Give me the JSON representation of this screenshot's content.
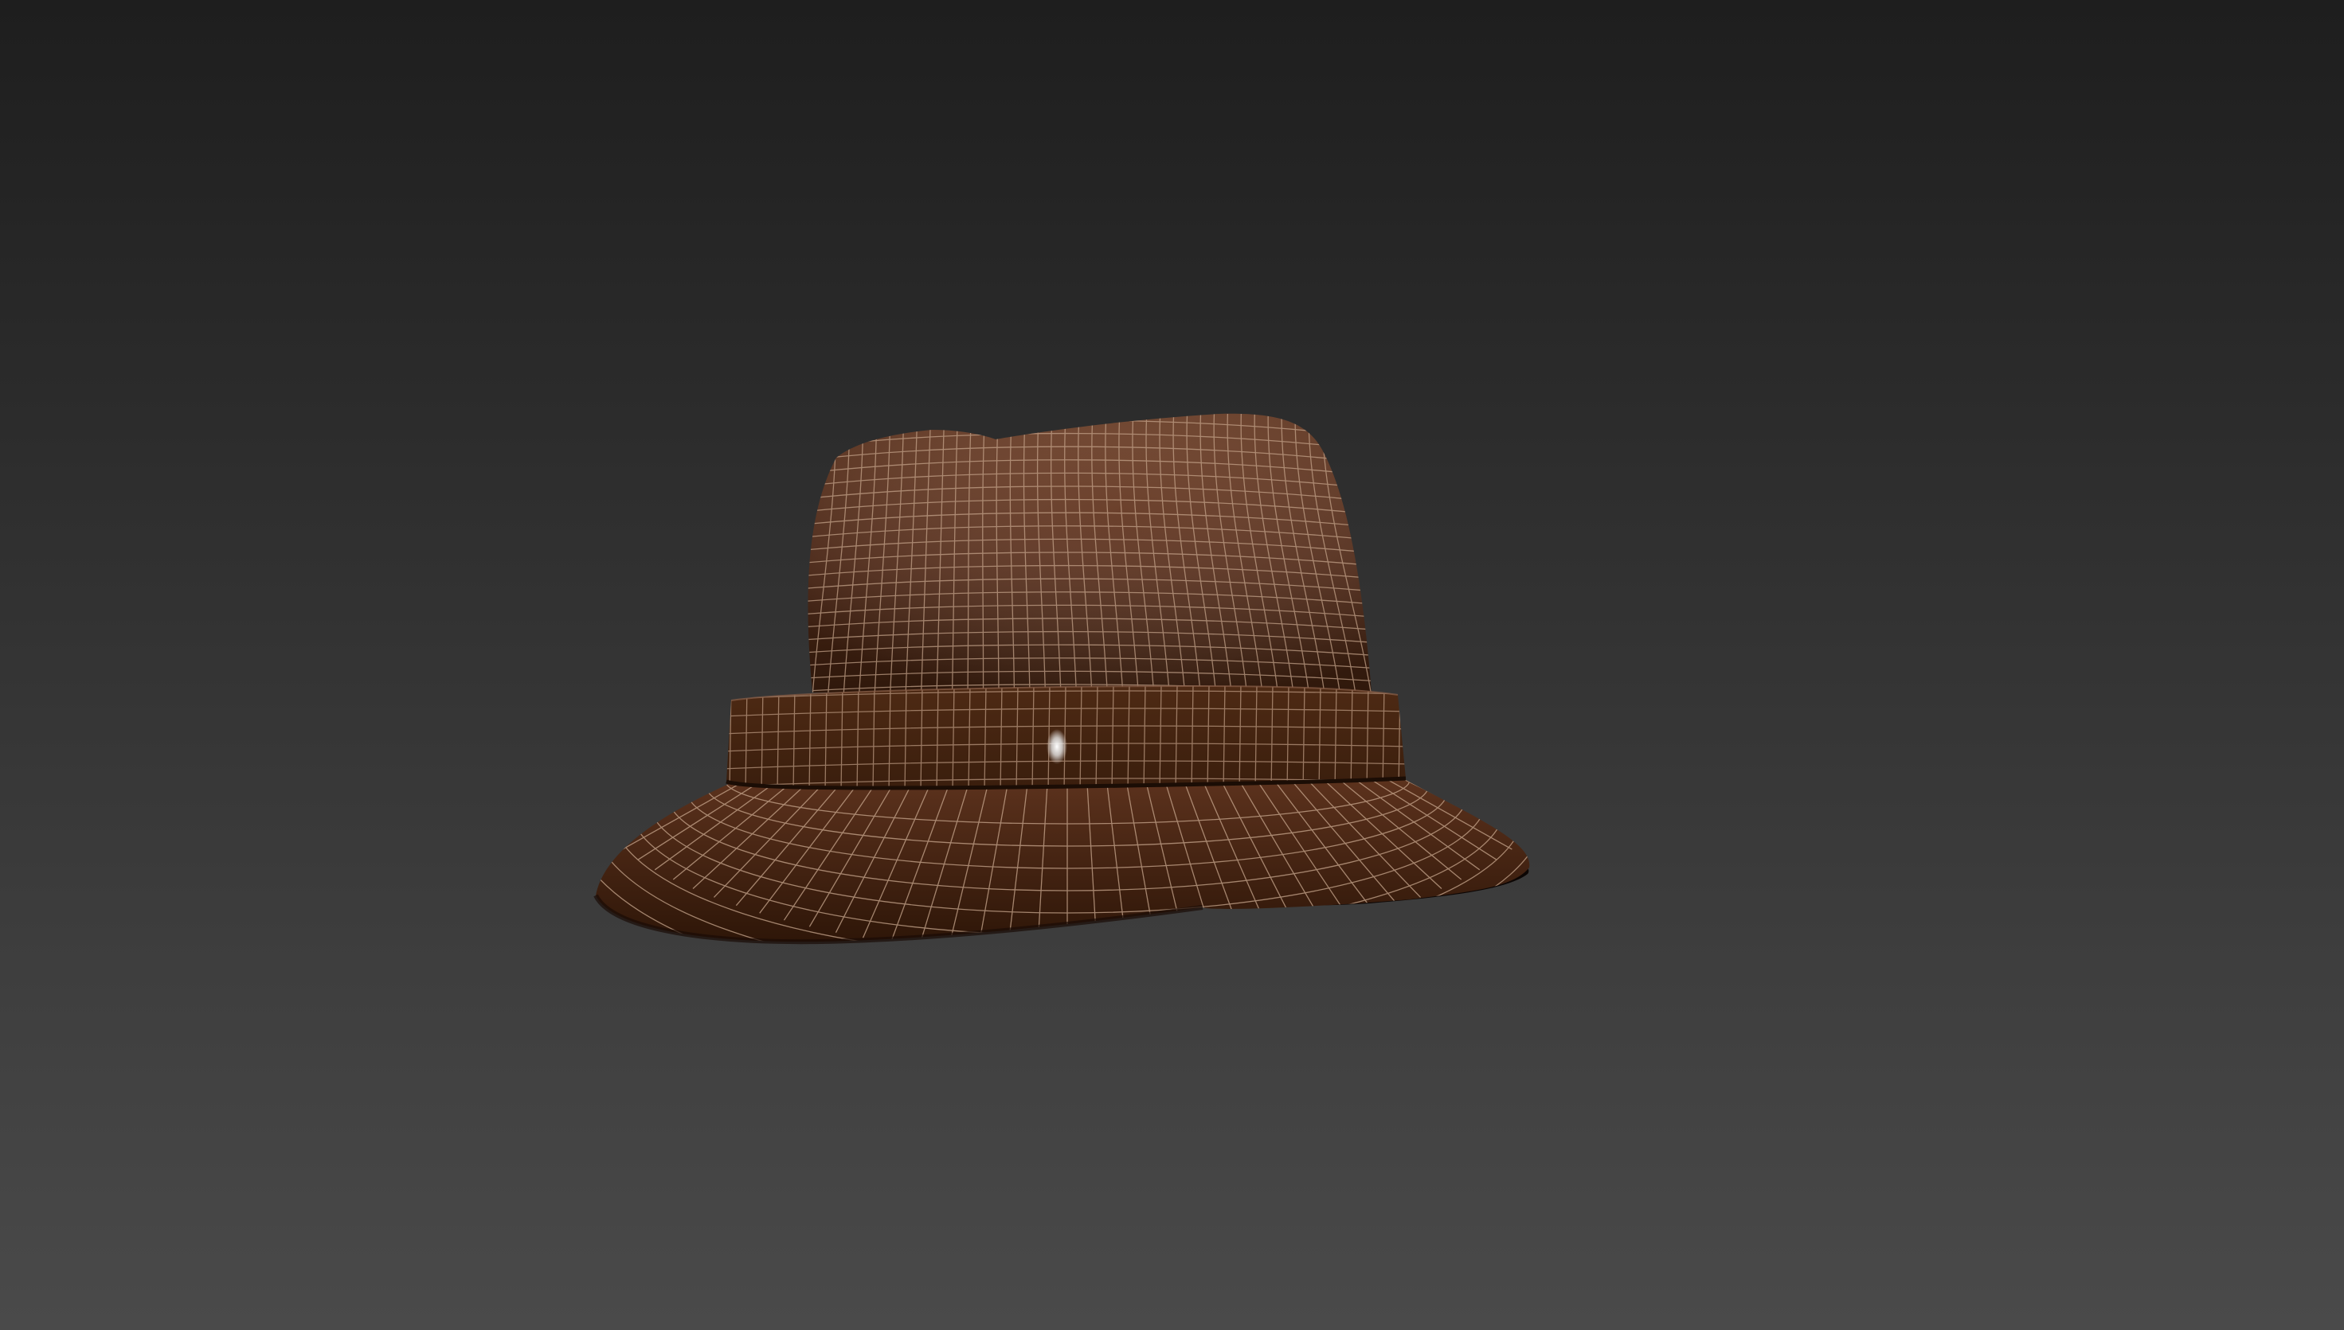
{
  "viewport": {
    "background_top": "#1e1e1e",
    "background_bottom": "#4a4a4a"
  },
  "model": {
    "name_icon": "hat-model-icon",
    "display_mode": "shaded-with-wireframe",
    "colors": {
      "crown_light": "#6e3d24",
      "crown_mid": "#5a2f1b",
      "crown_dark": "#3f200f",
      "band": "#3a1e0d",
      "band_light": "#4e2a14",
      "brim_light": "#5c321d",
      "brim_dark": "#2e1608",
      "underside": "#0c0604",
      "wire": "#c9a88f",
      "highlight": "#ffffff"
    }
  }
}
